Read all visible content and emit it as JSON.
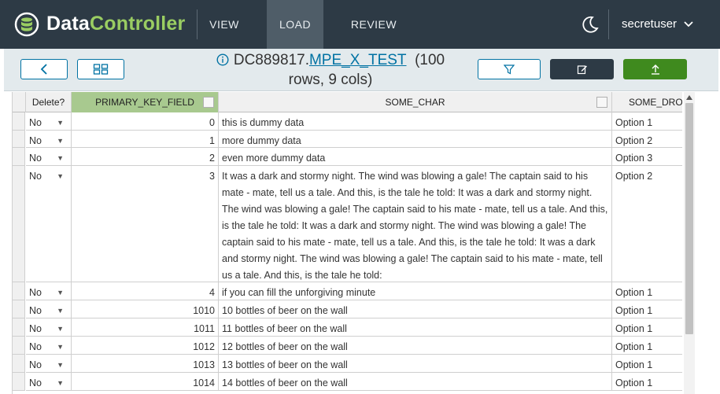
{
  "app": {
    "brand_part1": "Data",
    "brand_part2": "Controller"
  },
  "nav": {
    "tabs": [
      {
        "label": "VIEW"
      },
      {
        "label": "LOAD"
      },
      {
        "label": "REVIEW"
      }
    ],
    "user": "secretuser"
  },
  "toolbar": {
    "title_prefix": "DC889817.",
    "title_link": "MPE_X_TEST",
    "title_suffix": "(100 rows, 9 cols)"
  },
  "grid": {
    "columns": [
      "Delete?",
      "PRIMARY_KEY_FIELD",
      "SOME_CHAR",
      "SOME_DRO"
    ],
    "rows": [
      {
        "del": "No",
        "pk": "0",
        "char": "this is dummy data",
        "dro": "Option 1"
      },
      {
        "del": "No",
        "pk": "1",
        "char": "more dummy data",
        "dro": "Option 2"
      },
      {
        "del": "No",
        "pk": "2",
        "char": "even more dummy data",
        "dro": "Option 3"
      },
      {
        "del": "No",
        "pk": "3",
        "char": "It was a dark and stormy night.  The wind was blowing a gale!  The captain said to his mate - mate, tell us a tale.  And this, is the tale he told: It was a dark and stormy night.  The wind was blowing a gale!  The captain said to his mate - mate, tell us a tale.  And this, is the tale he told: It was a dark and stormy night.  The wind was blowing a gale!  The captain said to his mate - mate, tell us a tale.  And this, is the tale he told: It was a dark and stormy night.  The wind was blowing a gale!  The captain said to his mate - mate, tell us a tale.  And this, is the tale he told:",
        "dro": "Option 2"
      },
      {
        "del": "No",
        "pk": "4",
        "char": "if you can fill the unforgiving minute",
        "dro": "Option 1"
      },
      {
        "del": "No",
        "pk": "1010",
        "char": "10 bottles of beer on the wall",
        "dro": "Option 1"
      },
      {
        "del": "No",
        "pk": "1011",
        "char": "11 bottles of beer on the wall",
        "dro": "Option 1"
      },
      {
        "del": "No",
        "pk": "1012",
        "char": "12 bottles of beer on the wall",
        "dro": "Option 1"
      },
      {
        "del": "No",
        "pk": "1013",
        "char": "13 bottles of beer on the wall",
        "dro": "Option 1"
      },
      {
        "del": "No",
        "pk": "1014",
        "char": "14 bottles of beer on the wall",
        "dro": "Option 1"
      }
    ]
  },
  "icons": {
    "logo": "database-icon",
    "theme": "moon-icon",
    "user_menu": "chevron-down-icon",
    "back": "chevron-left-icon",
    "grid_view": "grid-icon",
    "info": "info-circle-icon",
    "filter": "filter-icon",
    "edit": "edit-icon",
    "upload": "upload-icon"
  },
  "colors": {
    "nav_bg": "#2d3a45",
    "brand_accent": "#9acd62",
    "primary": "#0072a3",
    "submit_green": "#3f8a1e",
    "sorted_header": "#a8c98f"
  }
}
